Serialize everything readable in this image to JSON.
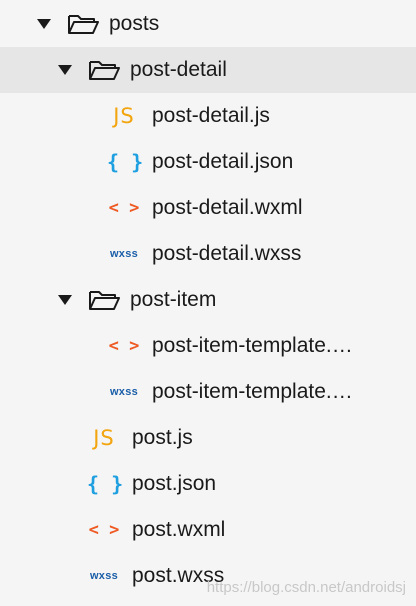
{
  "tree": {
    "posts": {
      "label": "posts",
      "children": {
        "post_detail": {
          "label": "post-detail",
          "files": [
            {
              "icon": "JS",
              "label": "post-detail.js"
            },
            {
              "icon": "{ }",
              "label": "post-detail.json"
            },
            {
              "icon": "< >",
              "label": "post-detail.wxml"
            },
            {
              "icon": "wxss",
              "label": "post-detail.wxss"
            }
          ]
        },
        "post_item": {
          "label": "post-item",
          "files": [
            {
              "icon": "< >",
              "label": "post-item-template.…"
            },
            {
              "icon": "wxss",
              "label": "post-item-template.…"
            }
          ]
        }
      },
      "files": [
        {
          "icon": "JS",
          "label": "post.js"
        },
        {
          "icon": "{ }",
          "label": "post.json"
        },
        {
          "icon": "< >",
          "label": "post.wxml"
        },
        {
          "icon": "wxss",
          "label": "post.wxss"
        }
      ]
    }
  },
  "watermark": "https://blog.csdn.net/androidsj",
  "colors": {
    "background": "#f5f5f5",
    "selected_row": "#e6e6e6",
    "js_icon": "#f2a50f",
    "json_icon": "#1e9fe0",
    "wxml_icon": "#ee5a24",
    "wxss_icon": "#1b5ea8"
  },
  "icons": {
    "expanded": "caret-down-icon",
    "folder": "folder-open-icon"
  }
}
